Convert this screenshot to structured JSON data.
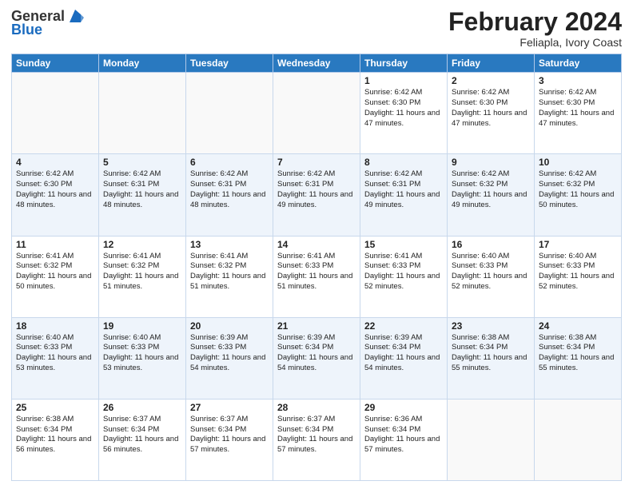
{
  "header": {
    "logo_general": "General",
    "logo_blue": "Blue",
    "month_title": "February 2024",
    "subtitle": "Feliapla, Ivory Coast"
  },
  "weekdays": [
    "Sunday",
    "Monday",
    "Tuesday",
    "Wednesday",
    "Thursday",
    "Friday",
    "Saturday"
  ],
  "weeks": [
    [
      {
        "day": "",
        "info": ""
      },
      {
        "day": "",
        "info": ""
      },
      {
        "day": "",
        "info": ""
      },
      {
        "day": "",
        "info": ""
      },
      {
        "day": "1",
        "info": "Sunrise: 6:42 AM\nSunset: 6:30 PM\nDaylight: 11 hours and 47 minutes."
      },
      {
        "day": "2",
        "info": "Sunrise: 6:42 AM\nSunset: 6:30 PM\nDaylight: 11 hours and 47 minutes."
      },
      {
        "day": "3",
        "info": "Sunrise: 6:42 AM\nSunset: 6:30 PM\nDaylight: 11 hours and 47 minutes."
      }
    ],
    [
      {
        "day": "4",
        "info": "Sunrise: 6:42 AM\nSunset: 6:30 PM\nDaylight: 11 hours and 48 minutes."
      },
      {
        "day": "5",
        "info": "Sunrise: 6:42 AM\nSunset: 6:31 PM\nDaylight: 11 hours and 48 minutes."
      },
      {
        "day": "6",
        "info": "Sunrise: 6:42 AM\nSunset: 6:31 PM\nDaylight: 11 hours and 48 minutes."
      },
      {
        "day": "7",
        "info": "Sunrise: 6:42 AM\nSunset: 6:31 PM\nDaylight: 11 hours and 49 minutes."
      },
      {
        "day": "8",
        "info": "Sunrise: 6:42 AM\nSunset: 6:31 PM\nDaylight: 11 hours and 49 minutes."
      },
      {
        "day": "9",
        "info": "Sunrise: 6:42 AM\nSunset: 6:32 PM\nDaylight: 11 hours and 49 minutes."
      },
      {
        "day": "10",
        "info": "Sunrise: 6:42 AM\nSunset: 6:32 PM\nDaylight: 11 hours and 50 minutes."
      }
    ],
    [
      {
        "day": "11",
        "info": "Sunrise: 6:41 AM\nSunset: 6:32 PM\nDaylight: 11 hours and 50 minutes."
      },
      {
        "day": "12",
        "info": "Sunrise: 6:41 AM\nSunset: 6:32 PM\nDaylight: 11 hours and 51 minutes."
      },
      {
        "day": "13",
        "info": "Sunrise: 6:41 AM\nSunset: 6:32 PM\nDaylight: 11 hours and 51 minutes."
      },
      {
        "day": "14",
        "info": "Sunrise: 6:41 AM\nSunset: 6:33 PM\nDaylight: 11 hours and 51 minutes."
      },
      {
        "day": "15",
        "info": "Sunrise: 6:41 AM\nSunset: 6:33 PM\nDaylight: 11 hours and 52 minutes."
      },
      {
        "day": "16",
        "info": "Sunrise: 6:40 AM\nSunset: 6:33 PM\nDaylight: 11 hours and 52 minutes."
      },
      {
        "day": "17",
        "info": "Sunrise: 6:40 AM\nSunset: 6:33 PM\nDaylight: 11 hours and 52 minutes."
      }
    ],
    [
      {
        "day": "18",
        "info": "Sunrise: 6:40 AM\nSunset: 6:33 PM\nDaylight: 11 hours and 53 minutes."
      },
      {
        "day": "19",
        "info": "Sunrise: 6:40 AM\nSunset: 6:33 PM\nDaylight: 11 hours and 53 minutes."
      },
      {
        "day": "20",
        "info": "Sunrise: 6:39 AM\nSunset: 6:33 PM\nDaylight: 11 hours and 54 minutes."
      },
      {
        "day": "21",
        "info": "Sunrise: 6:39 AM\nSunset: 6:34 PM\nDaylight: 11 hours and 54 minutes."
      },
      {
        "day": "22",
        "info": "Sunrise: 6:39 AM\nSunset: 6:34 PM\nDaylight: 11 hours and 54 minutes."
      },
      {
        "day": "23",
        "info": "Sunrise: 6:38 AM\nSunset: 6:34 PM\nDaylight: 11 hours and 55 minutes."
      },
      {
        "day": "24",
        "info": "Sunrise: 6:38 AM\nSunset: 6:34 PM\nDaylight: 11 hours and 55 minutes."
      }
    ],
    [
      {
        "day": "25",
        "info": "Sunrise: 6:38 AM\nSunset: 6:34 PM\nDaylight: 11 hours and 56 minutes."
      },
      {
        "day": "26",
        "info": "Sunrise: 6:37 AM\nSunset: 6:34 PM\nDaylight: 11 hours and 56 minutes."
      },
      {
        "day": "27",
        "info": "Sunrise: 6:37 AM\nSunset: 6:34 PM\nDaylight: 11 hours and 57 minutes."
      },
      {
        "day": "28",
        "info": "Sunrise: 6:37 AM\nSunset: 6:34 PM\nDaylight: 11 hours and 57 minutes."
      },
      {
        "day": "29",
        "info": "Sunrise: 6:36 AM\nSunset: 6:34 PM\nDaylight: 11 hours and 57 minutes."
      },
      {
        "day": "",
        "info": ""
      },
      {
        "day": "",
        "info": ""
      }
    ]
  ]
}
